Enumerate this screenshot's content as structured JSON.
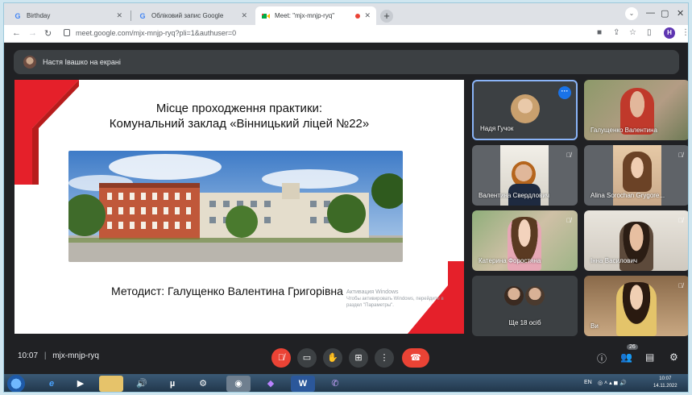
{
  "browser": {
    "tabs": [
      {
        "title": "Birthday",
        "icon": "google-g"
      },
      {
        "title": "Обліковий запис Google",
        "icon": "google-g"
      },
      {
        "title": "Meet: \"mjx-mnjp-ryq\"",
        "icon": "meet-logo"
      }
    ],
    "url": "meet.google.com/mjx-mnjp-ryq?pli=1&authuser=0",
    "profile_initial": "H"
  },
  "presenter_banner": {
    "text": "Настя Івашко на екрані"
  },
  "slide": {
    "title_line1": "Місце проходження практики:",
    "title_line2": "Комунальний заклад «Вінницький ліцей №22»",
    "methodist": "Методист:  Галущенко Валентина Григорівна",
    "watermark_line1": "Активация Windows",
    "watermark_line2": "Чтобы активировать Windows, перейдите в",
    "watermark_line3": "раздел \"Параметры\"."
  },
  "participants": [
    {
      "name": "Надя Гучок",
      "muted": false,
      "selected": true
    },
    {
      "name": "Галущенко Валентина",
      "muted": false
    },
    {
      "name": "Валентина Свердлович",
      "muted": true
    },
    {
      "name": "Alina Sorochan Grygore...",
      "muted": true
    },
    {
      "name": "Катерина Форостяна",
      "muted": true
    },
    {
      "name": "Інна Василович",
      "muted": true
    },
    {
      "name": "Ще 18 осіб",
      "muted": false
    },
    {
      "name": "Ви",
      "muted": true
    }
  ],
  "bottom_bar": {
    "time": "10:07",
    "separator": "|",
    "meeting_code": "mjx-mnjp-ryq",
    "participants_count": "26"
  },
  "taskbar": {
    "language": "EN",
    "time": "10:07",
    "date": "14.11.2022"
  },
  "colors": {
    "meet_bg": "#202124",
    "tile_bg": "#3c4043",
    "end_call_red": "#ea4335",
    "slide_red": "#e5202a",
    "selected_border": "#8ab4f8"
  }
}
